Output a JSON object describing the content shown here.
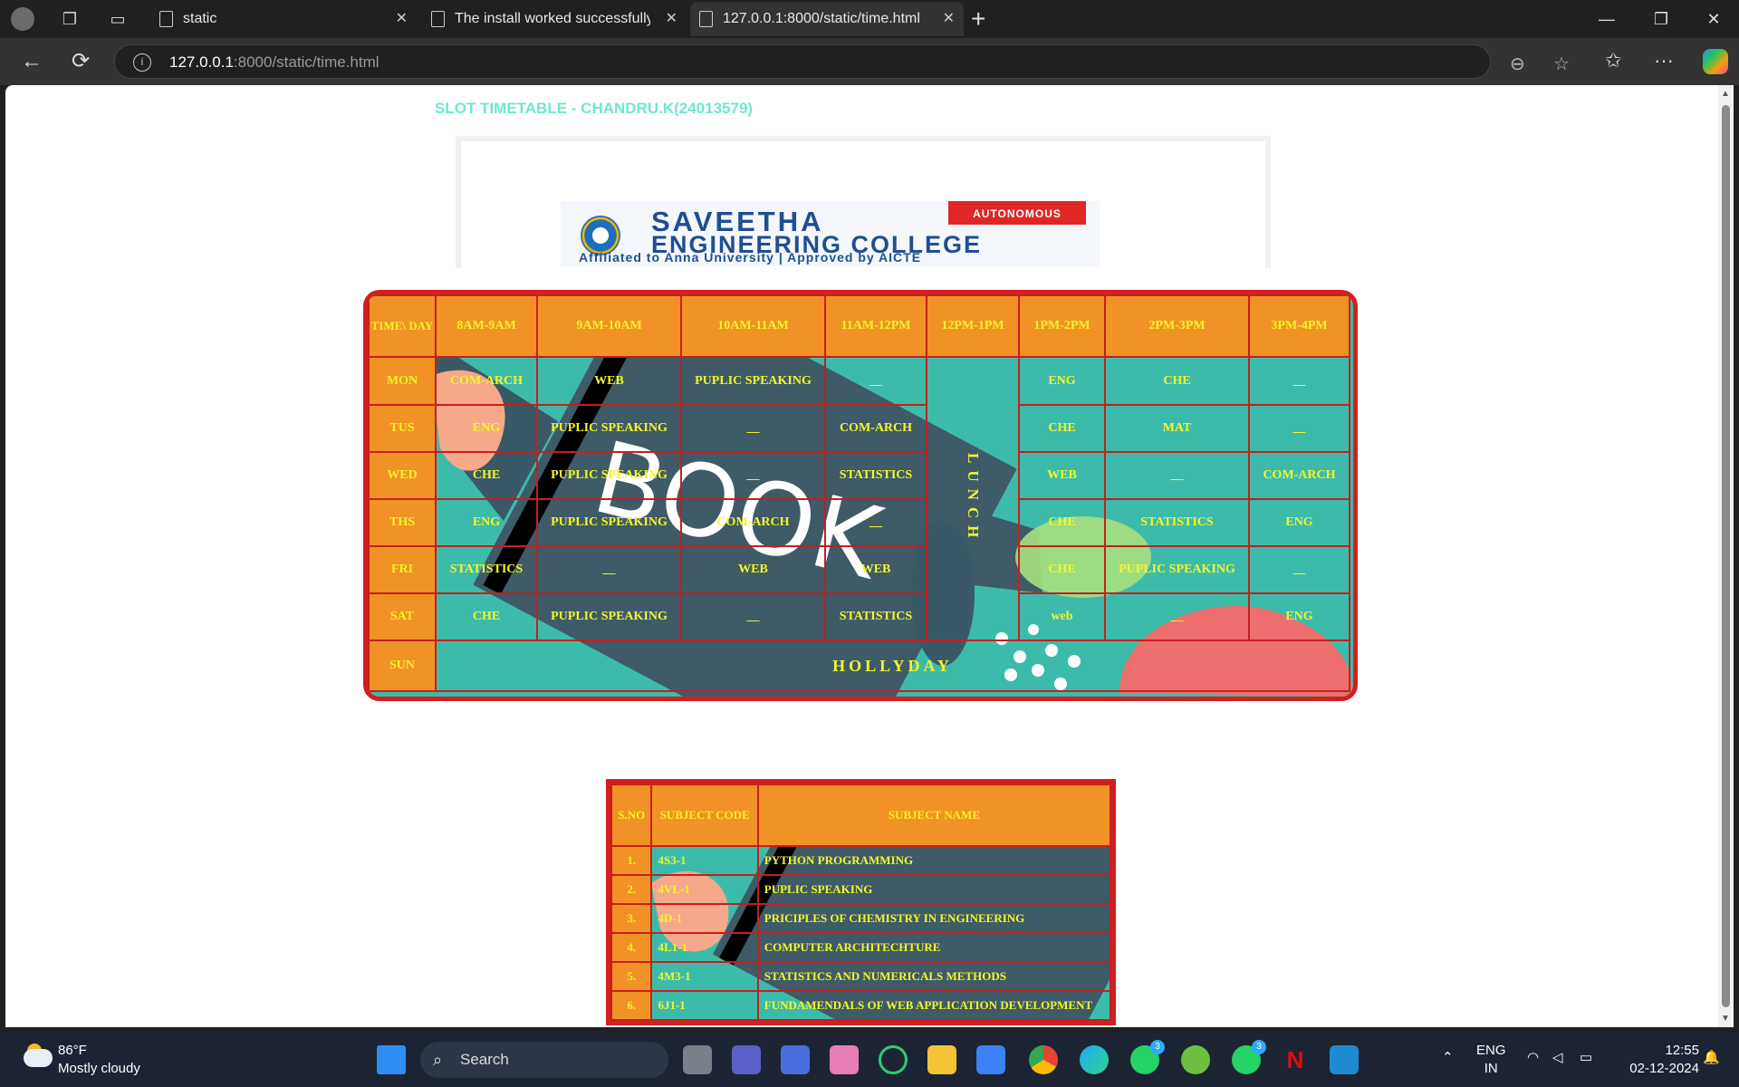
{
  "browser": {
    "tabs": [
      {
        "title": "static"
      },
      {
        "title": "The install worked successfully! Co"
      },
      {
        "title": "127.0.0.1:8000/static/time.html"
      }
    ],
    "url_host": "127.0.0.1",
    "url_path": ":8000/static/time.html"
  },
  "page": {
    "title": "SLOT TIMETABLE - CHANDRU.K(24013579)",
    "logo": {
      "line1": "SAVEETHA",
      "line2": "ENGINEERING COLLEGE",
      "line3": "Affiliated to Anna University | Approved by AICTE",
      "badge": "AUTONOMOUS"
    },
    "timetable": {
      "corner": "TIME\\ DAY",
      "slots": [
        "8AM-9AM",
        "9AM-10AM",
        "10AM-11AM",
        "11AM-12PM",
        "12PM-1PM",
        "1PM-2PM",
        "2PM-3PM",
        "3PM-4PM"
      ],
      "lunch": "LUNCH",
      "rows": [
        {
          "day": "MON",
          "before": [
            "COM-ARCH",
            "WEB",
            "PUPLIC SPEAKING",
            "__"
          ],
          "after": [
            "ENG",
            "CHE",
            "__"
          ]
        },
        {
          "day": "TUS",
          "before": [
            "ENG",
            "PUPLIC SPEAKING",
            "__",
            "COM-ARCH"
          ],
          "after": [
            "CHE",
            "MAT",
            "__"
          ]
        },
        {
          "day": "WED",
          "before": [
            "CHE",
            "PUPLIC SPEAKING",
            "__",
            "STATISTICS"
          ],
          "after": [
            "WEB",
            "__",
            "COM-ARCH"
          ]
        },
        {
          "day": "THS",
          "before": [
            "ENG",
            "PUPLIC SPEAKING",
            "COM-ARCH",
            "__"
          ],
          "after": [
            "CHE",
            "STATISTICS",
            "ENG"
          ]
        },
        {
          "day": "FRI",
          "before": [
            "STATISTICS",
            "__",
            "WEB",
            "WEB"
          ],
          "after": [
            "CHE",
            "PUPLIC SPEAKING",
            "__"
          ]
        },
        {
          "day": "SAT",
          "before": [
            "CHE",
            "PUPLIC SPEAKING",
            "__",
            "STATISTICS"
          ],
          "after": [
            "web",
            "__",
            "ENG"
          ]
        }
      ],
      "sunday": {
        "day": "SUN",
        "text": "HOLLYDAY"
      },
      "art_text": "BOOK"
    },
    "subjects": {
      "headers": [
        "S.NO",
        "SUBJECT CODE",
        "SUBJECT NAME"
      ],
      "rows": [
        {
          "sno": "1.",
          "code": "4S3-1",
          "name": "PYTHON PROGRAMMING"
        },
        {
          "sno": "2.",
          "code": "4VL-1",
          "name": "PUPLIC SPEAKING"
        },
        {
          "sno": "3.",
          "code": "4D-1",
          "name": "PRICIPLES OF CHEMISTRY IN ENGINEERING"
        },
        {
          "sno": "4.",
          "code": "4L1-1",
          "name": "COMPUTER ARCHITECHTURE"
        },
        {
          "sno": "5.",
          "code": "4M3-1",
          "name": "STATISTICS AND NUMERICALS METHODS"
        },
        {
          "sno": "6.",
          "code": "6J1-1",
          "name": "FUNDAMENDALS OF WEB APPLICATION DEVELOPMENT"
        }
      ]
    }
  },
  "taskbar": {
    "weather_temp": "86°F",
    "weather_desc": "Mostly cloudy",
    "search": "Search",
    "lang1": "ENG",
    "lang2": "IN",
    "time": "12:55",
    "date": "02-12-2024",
    "badge_whatsapp": "3",
    "badge_whatsapp2": "3"
  }
}
